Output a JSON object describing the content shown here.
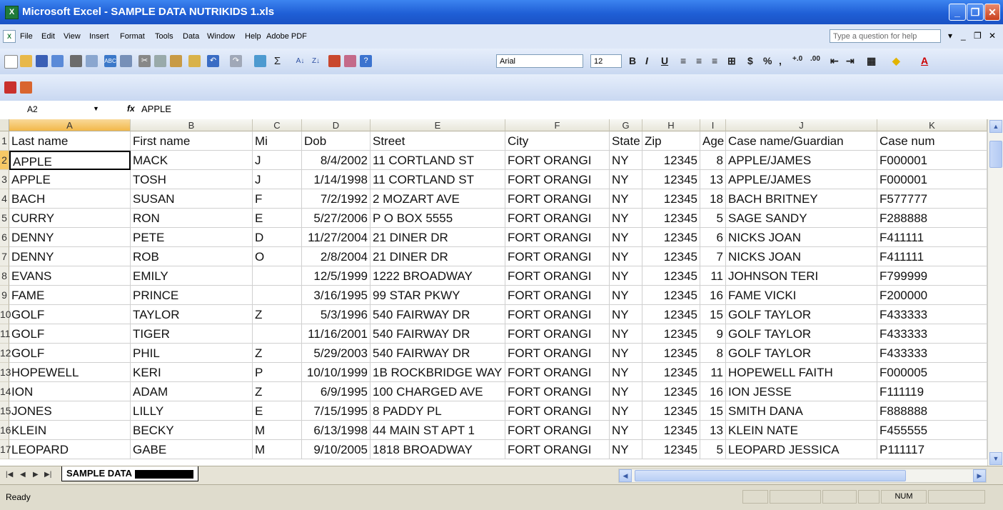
{
  "window": {
    "title": "Microsoft Excel - SAMPLE DATA NUTRIKIDS 1.xls",
    "app_icon": "excel-icon",
    "controls": [
      "minimize",
      "restore",
      "close"
    ]
  },
  "menu": {
    "items": [
      "File",
      "Edit",
      "View",
      "Insert",
      "Format",
      "Tools",
      "Data",
      "Window",
      "Help",
      "Adobe PDF"
    ],
    "help_placeholder": "Type a question for help"
  },
  "toolbar": {
    "font_name": "Arial",
    "font_size": "12",
    "bold": "B",
    "italic": "I",
    "underline": "U",
    "currency": "$",
    "percent": "%",
    "comma": ","
  },
  "formula_bar": {
    "cell_ref": "A2",
    "fx": "fx",
    "value": "APPLE"
  },
  "grid": {
    "selected_cell": "A2",
    "columns": [
      "A",
      "B",
      "C",
      "D",
      "E",
      "F",
      "G",
      "H",
      "I",
      "J",
      "K"
    ],
    "rows": [
      {
        "n": "1",
        "cells": [
          "Last name",
          "First name",
          "Mi",
          "Dob",
          "Street",
          "City",
          "State",
          "Zip",
          "Age",
          "Case name/Guardian",
          "Case num"
        ]
      },
      {
        "n": "2",
        "cells": [
          "APPLE",
          "MACK",
          "J",
          "8/4/2002",
          "11 CORTLAND ST",
          "FORT ORANGI",
          "NY",
          "12345",
          "8",
          "APPLE/JAMES",
          "F000001"
        ]
      },
      {
        "n": "3",
        "cells": [
          "APPLE",
          "TOSH",
          "J",
          "1/14/1998",
          "11 CORTLAND ST",
          "FORT ORANGI",
          "NY",
          "12345",
          "13",
          "APPLE/JAMES",
          "F000001"
        ]
      },
      {
        "n": "4",
        "cells": [
          "BACH",
          "SUSAN",
          "F",
          "7/2/1992",
          "2 MOZART AVE",
          "FORT ORANGI",
          "NY",
          "12345",
          "18",
          "BACH BRITNEY",
          "F577777"
        ]
      },
      {
        "n": "5",
        "cells": [
          "CURRY",
          "RON",
          "E",
          "5/27/2006",
          "P O BOX 5555",
          "FORT ORANGI",
          "NY",
          "12345",
          "5",
          "SAGE SANDY",
          "F288888"
        ]
      },
      {
        "n": "6",
        "cells": [
          "DENNY",
          "PETE",
          "D",
          "11/27/2004",
          "21 DINER DR",
          "FORT ORANGI",
          "NY",
          "12345",
          "6",
          "NICKS  JOAN",
          "F411111"
        ]
      },
      {
        "n": "7",
        "cells": [
          "DENNY",
          "ROB",
          "O",
          "2/8/2004",
          "21 DINER DR",
          "FORT ORANGI",
          "NY",
          "12345",
          "7",
          "NICKS  JOAN",
          "F411111"
        ]
      },
      {
        "n": "8",
        "cells": [
          "EVANS",
          "EMILY",
          "",
          "12/5/1999",
          "1222 BROADWAY",
          "FORT ORANGI",
          "NY",
          "12345",
          "11",
          "JOHNSON TERI",
          "F799999"
        ]
      },
      {
        "n": "9",
        "cells": [
          "FAME",
          "PRINCE",
          "",
          "3/16/1995",
          "99 STAR PKWY",
          "FORT ORANGI",
          "NY",
          "12345",
          "16",
          "FAME VICKI",
          "F200000"
        ]
      },
      {
        "n": "10",
        "cells": [
          "GOLF",
          "TAYLOR",
          "Z",
          "5/3/1996",
          "540 FAIRWAY DR",
          "FORT ORANGI",
          "NY",
          "12345",
          "15",
          "GOLF TAYLOR",
          "F433333"
        ]
      },
      {
        "n": "11",
        "cells": [
          "GOLF",
          "TIGER",
          "",
          "11/16/2001",
          "540 FAIRWAY DR",
          "FORT ORANGI",
          "NY",
          "12345",
          "9",
          "GOLF TAYLOR",
          "F433333"
        ]
      },
      {
        "n": "12",
        "cells": [
          "GOLF",
          "PHIL",
          "Z",
          "5/29/2003",
          "540 FAIRWAY DR",
          "FORT ORANGI",
          "NY",
          "12345",
          "8",
          "GOLF TAYLOR",
          "F433333"
        ]
      },
      {
        "n": "13",
        "cells": [
          "HOPEWELL",
          "KERI",
          "P",
          "10/10/1999",
          "1B ROCKBRIDGE WAY",
          "FORT ORANGI",
          "NY",
          "12345",
          "11",
          "HOPEWELL FAITH",
          "F000005"
        ]
      },
      {
        "n": "14",
        "cells": [
          "ION",
          "ADAM",
          "Z",
          "6/9/1995",
          "100 CHARGED AVE",
          "FORT ORANGI",
          "NY",
          "12345",
          "16",
          "ION JESSE",
          "F111119"
        ]
      },
      {
        "n": "15",
        "cells": [
          "JONES",
          "LILLY",
          "E",
          "7/15/1995",
          "8 PADDY PL",
          "FORT ORANGI",
          "NY",
          "12345",
          "15",
          "SMITH DANA",
          "F888888"
        ]
      },
      {
        "n": "16",
        "cells": [
          "KLEIN",
          "BECKY",
          "M",
          "6/13/1998",
          "44 MAIN ST APT 1",
          "FORT ORANGI",
          "NY",
          "12345",
          "13",
          "KLEIN NATE",
          "F455555"
        ]
      },
      {
        "n": "17",
        "cells": [
          "LEOPARD",
          "GABE",
          "M",
          "9/10/2005",
          "1818 BROADWAY",
          "FORT ORANGI",
          "NY",
          "12345",
          "5",
          "LEOPARD JESSICA",
          "P111117"
        ]
      }
    ]
  },
  "sheet_tabs": {
    "active": "SAMPLE DATA"
  },
  "status": {
    "mode": "Ready",
    "num": "NUM"
  }
}
